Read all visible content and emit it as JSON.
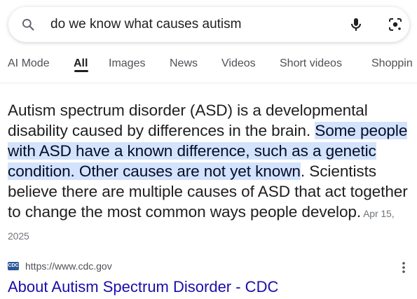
{
  "search": {
    "query": "do we know what causes autism"
  },
  "tabs": [
    {
      "label": "AI Mode",
      "active": false
    },
    {
      "label": "All",
      "active": true
    },
    {
      "label": "Images",
      "active": false
    },
    {
      "label": "News",
      "active": false
    },
    {
      "label": "Videos",
      "active": false
    },
    {
      "label": "Short videos",
      "active": false
    },
    {
      "label": "Shoppin",
      "active": false
    }
  ],
  "answer": {
    "part1": "Autism spectrum disorder (ASD) is a developmental disability caused by differences in the brain. ",
    "highlight1": "Some people with ASD have a known difference, such as a genetic condition. ",
    "highlight2": "Other causes are not yet known",
    "part2": ". Scientists believe there are multiple causes of ASD that act together to change the most common ways people develop.",
    "date": "Apr 15, 2025"
  },
  "source": {
    "favicon_text": "CDC",
    "url": "https://www.cdc.gov",
    "title": "About Autism Spectrum Disorder - CDC"
  },
  "colors": {
    "highlight": "#d3e3fd",
    "link": "#1a0dab"
  }
}
